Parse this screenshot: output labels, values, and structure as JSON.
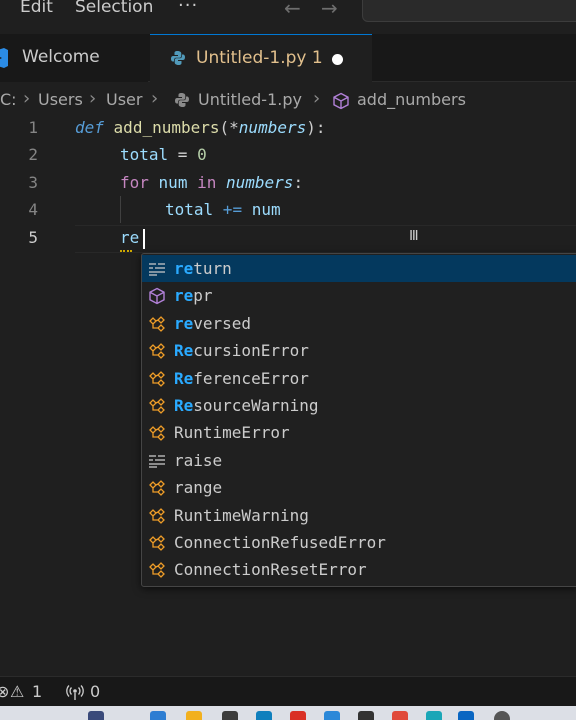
{
  "menu": {
    "items": [
      "Edit",
      "Selection"
    ],
    "more": "···"
  },
  "tabs": [
    {
      "label": "Welcome",
      "active": false
    },
    {
      "label": "Untitled-1.py 1",
      "active": true,
      "dirty": true
    }
  ],
  "breadcrumb": {
    "items": [
      "C:",
      "Users",
      "User",
      "Untitled-1.py",
      "add_numbers"
    ]
  },
  "editor": {
    "line_numbers": [
      "1",
      "2",
      "3",
      "4",
      "5"
    ],
    "lines": {
      "l1": {
        "def": "def",
        "name": "add_numbers",
        "open": "(",
        "star": "*",
        "param": "numbers",
        "close": "):"
      },
      "l2": {
        "var": "total",
        "op": " = ",
        "num": "0"
      },
      "l3": {
        "for": "for",
        "var": "num",
        "in": "in",
        "iter": "numbers",
        "colon": ":"
      },
      "l4": {
        "var": "total",
        "op": " += ",
        "var2": "num"
      },
      "l5": {
        "typed": "re"
      }
    }
  },
  "suggestions": {
    "selected_index": 0,
    "items": [
      {
        "match": "re",
        "rest": "turn",
        "kind": "keyword-icon"
      },
      {
        "match": "re",
        "rest": "pr",
        "kind": "method-icon"
      },
      {
        "match": "re",
        "rest": "versed",
        "kind": "class-icon"
      },
      {
        "match": "Re",
        "rest": "cursionError",
        "kind": "class-icon"
      },
      {
        "match": "Re",
        "rest": "ferenceError",
        "kind": "class-icon"
      },
      {
        "match": "Re",
        "rest": "sourceWarning",
        "kind": "class-icon"
      },
      {
        "match": "",
        "rest": "RuntimeError",
        "kind": "class-icon"
      },
      {
        "match": "",
        "rest": "raise",
        "kind": "keyword-icon"
      },
      {
        "match": "",
        "rest": "range",
        "kind": "class-icon"
      },
      {
        "match": "",
        "rest": "RuntimeWarning",
        "kind": "class-icon"
      },
      {
        "match": "",
        "rest": "ConnectionRefusedError",
        "kind": "class-icon"
      },
      {
        "match": "",
        "rest": "ConnectionResetError",
        "kind": "class-icon"
      }
    ]
  },
  "statusbar": {
    "problems": "1",
    "ports": "0"
  },
  "colors": {
    "accent": "#0078d4",
    "match_highlight": "#2aaaff",
    "selection": "#04395e",
    "modified_tab": "#e2c08d"
  }
}
